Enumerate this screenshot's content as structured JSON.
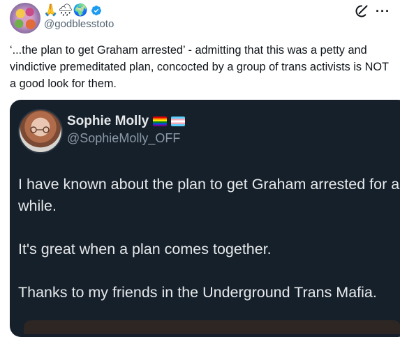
{
  "tweet": {
    "display_name_emojis": "🙏🌧🌍",
    "handle": "@godblesstoto",
    "text": "‘...the plan to get Graham arrested’ - admitting that this was a petty and vindictive premeditated plan, concocted by a group of trans activists is NOT a good look for them."
  },
  "top_icons": {
    "grok": "grok-icon",
    "more": "···"
  },
  "quote": {
    "name": "Sophie Molly",
    "handle": "@SophieMolly_OFF",
    "text": "I have known about the plan to get Graham arrested for a while.\n\nIt's great when a plan comes together.\n\nThanks to my friends in the Underground Trans Mafia."
  },
  "colors": {
    "card_bg": "#15202b",
    "verified": "#1d9bf0",
    "muted": "#536471"
  }
}
